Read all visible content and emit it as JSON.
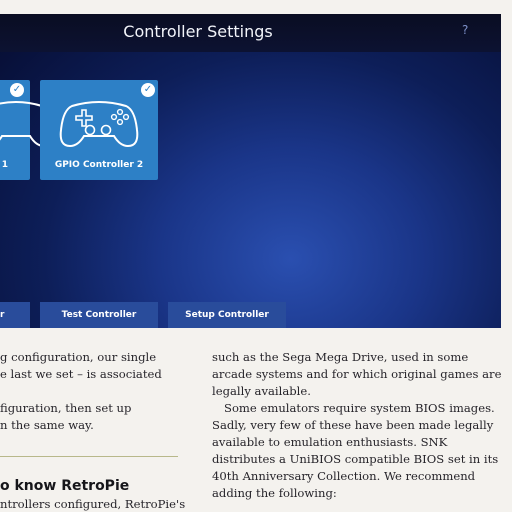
{
  "screen": {
    "title": "Controller Settings",
    "help_label": "?",
    "controllers": [
      {
        "label": "r 1",
        "configured": true,
        "check_glyph": "✓",
        "icon": "gamepad-icon"
      },
      {
        "label": "GPIO Controller 2",
        "configured": true,
        "check_glyph": "✓",
        "icon": "gamepad-icon"
      }
    ],
    "buttons": [
      {
        "label": "r"
      },
      {
        "label": "Test Controller"
      },
      {
        "label": "Setup Controller"
      }
    ],
    "colors": {
      "tile": "#2d80c6",
      "button": "#294c9b",
      "bar": "#0a0d22"
    }
  },
  "article": {
    "left_lines": [
      "g configuration, our single",
      "e last we set – is associated",
      "",
      "figuration, then set up",
      "n the same way."
    ],
    "heading": "o know RetroPie",
    "tail": "ntrollers configured, RetroPie's",
    "right_paragraphs": [
      {
        "text": "such as the Sega Mega Drive, used in some arcade systems and for which original games are legally available.",
        "indent": false
      },
      {
        "text": "Some emulators require system BIOS images. Sadly, very few of these have been made legally available to emulation enthusiasts. SNK distributes a UniBIOS compatible BIOS set in its 40th Anniversary Collection. We recommend adding the following:",
        "indent": true
      }
    ]
  }
}
